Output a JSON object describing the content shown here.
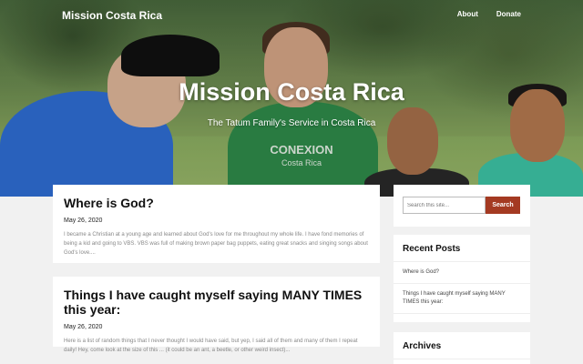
{
  "header": {
    "brand": "Mission Costa Rica",
    "nav": [
      "About",
      "Donate"
    ]
  },
  "hero": {
    "title": "Mission Costa Rica",
    "tagline": "The Tatum Family's Service in Costa Rica",
    "shirt_text": "CONEXION",
    "shirt_subtext": "Costa Rica"
  },
  "posts": [
    {
      "title": "Where is God?",
      "date": "May 26, 2020",
      "excerpt": "I became a Christian at a young age and learned about God's love for me throughout my whole life. I have fond memories of being a kid and going to VBS. VBS was full of making brown paper bag puppets, eating great snacks and singing songs about God's love...."
    },
    {
      "title": "Things I have caught myself saying MANY TIMES this year:",
      "date": "May 26, 2020",
      "excerpt": "Here is a list of random things that I never thought I would have said, but yep, I said all of them and many of them I repeat daily! Hey, come look at the size of this ... (it could be an ant, a beetle, or other weird insect)..."
    }
  ],
  "sidebar": {
    "search": {
      "placeholder": "Search this site...",
      "button": "Search"
    },
    "recent": {
      "title": "Recent Posts",
      "items": [
        "Where is God?",
        "Things I have caught myself saying MANY TIMES this year:"
      ]
    },
    "archives": {
      "title": "Archives"
    }
  },
  "colors": {
    "accent": "#a43a22",
    "background": "#f1f1f1"
  }
}
